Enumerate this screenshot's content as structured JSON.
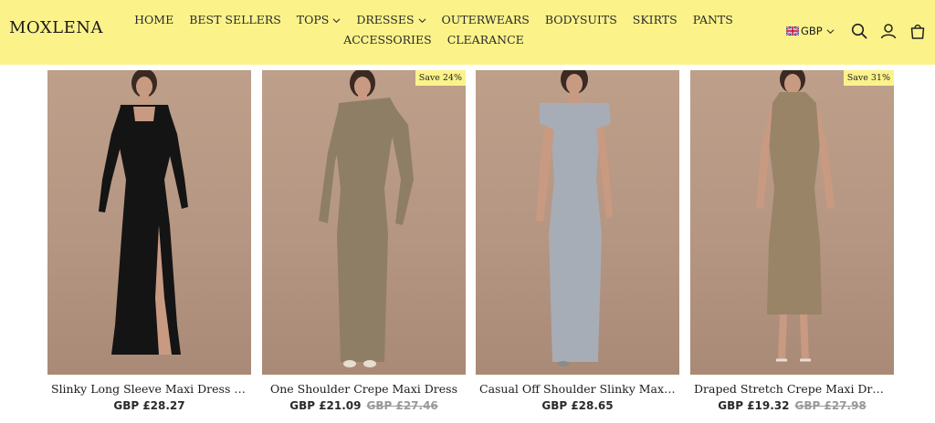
{
  "header": {
    "logo": "MOXLENA",
    "nav": [
      {
        "label": "HOME",
        "dropdown": false
      },
      {
        "label": "BEST SELLERS",
        "dropdown": false
      },
      {
        "label": "TOPS",
        "dropdown": true
      },
      {
        "label": "DRESSES",
        "dropdown": true
      },
      {
        "label": "OUTERWEARS",
        "dropdown": false
      },
      {
        "label": "BODYSUITS",
        "dropdown": false
      },
      {
        "label": "SKIRTS",
        "dropdown": false
      },
      {
        "label": "PANTS",
        "dropdown": false
      },
      {
        "label": "ACCESSORIES",
        "dropdown": false
      },
      {
        "label": "CLEARANCE",
        "dropdown": false
      }
    ],
    "currency": "GBP",
    "icons": [
      "search-icon",
      "account-icon",
      "cart-icon"
    ]
  },
  "products": [
    {
      "title": "Slinky Long Sleeve Maxi Dress With...",
      "price": "GBP £28.27",
      "old_price": "",
      "badge": "",
      "dress_color": "#141414"
    },
    {
      "title": "One Shoulder Crepe Maxi Dress",
      "price": "GBP £21.09",
      "old_price": "GBP £27.46",
      "badge": "Save 24%",
      "dress_color": "#8e7e66"
    },
    {
      "title": "Casual Off Shoulder Slinky Maxi Dr...",
      "price": "GBP £28.65",
      "old_price": "",
      "badge": "",
      "dress_color": "#a6adb7"
    },
    {
      "title": "Draped Stretch Crepe Maxi Dress",
      "price": "GBP £19.32",
      "old_price": "GBP £27.98",
      "badge": "Save 31%",
      "dress_color": "#9a8467"
    }
  ],
  "colors": {
    "header_bg": "#fbf38a",
    "badge_bg": "#fbf38a"
  }
}
